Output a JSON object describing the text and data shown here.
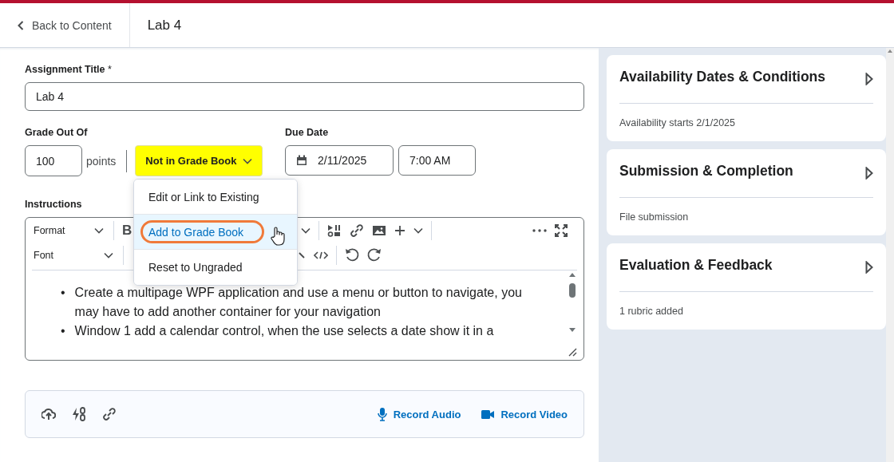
{
  "header": {
    "back_link": "Back to Content",
    "title": "Lab 4"
  },
  "assignment_title": {
    "label": "Assignment Title",
    "required_mark": "*",
    "value": "Lab 4"
  },
  "grade": {
    "label": "Grade Out Of",
    "value": "100",
    "unit": "points",
    "grade_book_button": "Not in Grade Book",
    "menu": [
      {
        "label": "Edit or Link to Existing",
        "selected": false
      },
      {
        "label": "Add to Grade Book",
        "selected": true
      },
      {
        "label": "Reset to Ungraded",
        "selected": false
      }
    ]
  },
  "due_date": {
    "label": "Due Date",
    "date": "2/11/2025",
    "time": "7:00 AM"
  },
  "instructions": {
    "label": "Instructions",
    "format_select": "Format",
    "font_select": "Font",
    "bold_button": "B",
    "bullets": [
      {
        "marker": "•",
        "text": "Create a multipage WPF application and use a menu or button to navigate, you may have to add another container for your navigation"
      },
      {
        "marker": "•",
        "text": "Window 1 add a calendar control, when the use selects a date show it in a"
      }
    ]
  },
  "attachments": {
    "record_audio": "Record Audio",
    "record_video": "Record Video"
  },
  "panels": [
    {
      "title": "Availability Dates & Conditions",
      "summary": "Availability starts 2/1/2025"
    },
    {
      "title": "Submission & Completion",
      "summary": "File submission"
    },
    {
      "title": "Evaluation & Feedback",
      "summary": "1 rubric added"
    }
  ]
}
